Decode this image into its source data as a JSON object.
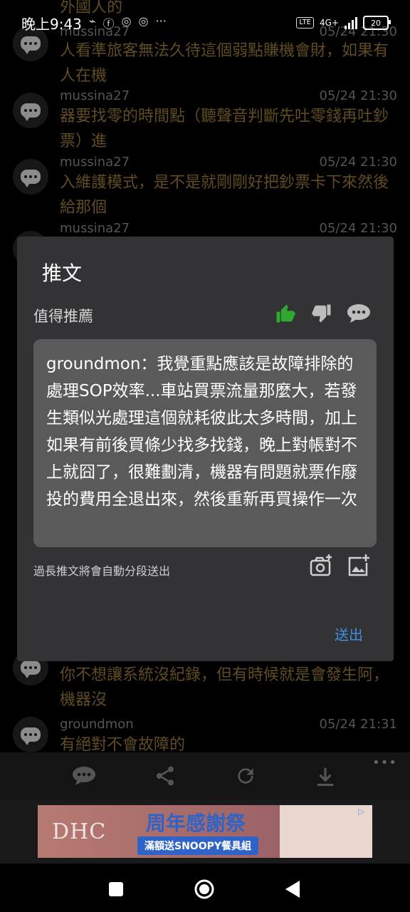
{
  "status_bar": {
    "time": "晚上9:43",
    "network": "4G+",
    "volte": "LTE",
    "battery": "20"
  },
  "comments": [
    {
      "user": "",
      "time": "",
      "text": "外國人的"
    },
    {
      "user": "mussina27",
      "time": "05/24 21:30",
      "text": "人看準旅客無法久待這個弱點賺機會財，如果有人在機"
    },
    {
      "user": "mussina27",
      "time": "05/24 21:30",
      "text": "器要找零的時間點（聽聲音判斷先吐零錢再吐鈔票）進"
    },
    {
      "user": "mussina27",
      "time": "05/24 21:30",
      "text": "入維護模式，是不是就剛剛好把鈔票卡下來然後給那個"
    },
    {
      "user": "mussina27",
      "time": "05/24 21:30",
      "text": ""
    },
    {
      "user": "",
      "time": "",
      "text": "你不想讓系統沒紀錄，但有時候就是會發生阿，機器沒"
    },
    {
      "user": "groundmon",
      "time": "05/24 21:31",
      "text": "有絕對不會故障的"
    }
  ],
  "dialog": {
    "title": "推文",
    "recommend_label": "值得推薦",
    "text": "groundmon：我覺重點應該是故障排除的處理SOP效率...車站買票流量那麼大，若發生類似光處理這個就耗彼此太多時間，加上如果有前後買條少找多找錢，晚上對帳對不上就囧了，很難劃清，機器有問題就票作廢投的費用全退出來，然後重新再買操作一次",
    "hint": "過長推文將會自動分段送出",
    "send_label": "送出",
    "colors": {
      "thumb_up": "#2fa82f",
      "thumb_down": "#bdbdbd",
      "send": "#3d8fe0"
    }
  },
  "toolbar": {
    "icons": [
      "comment-icon",
      "share-icon",
      "refresh-icon",
      "download-icon",
      "more-icon"
    ],
    "more": "•••"
  },
  "ad": {
    "brand": "DHC",
    "title": "周年感謝祭",
    "subtitle": "滿額送SNOOPY餐具組"
  }
}
